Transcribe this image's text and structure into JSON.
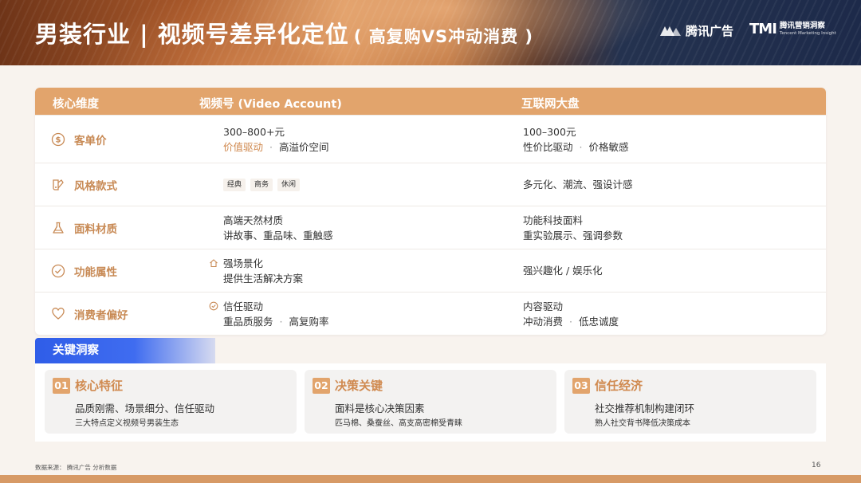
{
  "header": {
    "title": "男装行业 | 视频号差异化定位",
    "subtitle": "( 高复购VS冲动消费 )",
    "brand_tencent": "腾讯广告",
    "brand_tmi_logo": "TMI",
    "brand_tmi_cn": "腾讯营销洞察",
    "brand_tmi_en": "Tencent Marketing Insight"
  },
  "table": {
    "headers": [
      "核心维度",
      "视频号 (Video Account)",
      "互联网大盘"
    ],
    "rows": [
      {
        "dimension": "客单价",
        "icon": "dollar-circle-icon",
        "video": {
          "line1": "300–800+元",
          "line2a": "价值驱动",
          "sep": "·",
          "line2b": "高溢价空间"
        },
        "internet": {
          "line1": "100–300元",
          "line2a": "性价比驱动",
          "sep": "·",
          "line2b": "价格敏感"
        }
      },
      {
        "dimension": "风格款式",
        "icon": "style-palette-icon",
        "video": {
          "tags": [
            "经典",
            "商务",
            "休闲"
          ]
        },
        "internet": {
          "line1": "多元化、潮流、强设计感"
        }
      },
      {
        "dimension": "面料材质",
        "icon": "flask-icon",
        "video": {
          "line1": "高端天然材质",
          "line2": "讲故事、重品味、重触感"
        },
        "internet": {
          "line1": "功能科技面料",
          "line2": "重实验展示、强调参数"
        }
      },
      {
        "dimension": "功能属性",
        "icon": "check-circle-icon",
        "video": {
          "line1": "强场景化",
          "line2": "提供生活解决方案"
        },
        "internet": {
          "line1": "强兴趣化 / 娱乐化"
        }
      },
      {
        "dimension": "消费者偏好",
        "icon": "heart-icon",
        "video": {
          "line1": "信任驱动",
          "line2a": "重品质服务",
          "sep": "·",
          "line2b": "高复购率"
        },
        "internet": {
          "line1": "内容驱动",
          "line2a": "冲动消费",
          "sep": "·",
          "line2b": "低忠诚度"
        }
      }
    ]
  },
  "insights": {
    "heading": "关键洞察",
    "cards": [
      {
        "num": "01",
        "title": "核心特征",
        "line1": "品质刚需、场景细分、信任驱动",
        "line2": "三大特点定义视频号男装生态"
      },
      {
        "num": "02",
        "title": "决策关键",
        "line1": "面料是核心决策因素",
        "line2": "匹马棉、桑蚕丝、高支高密棉受青睐"
      },
      {
        "num": "03",
        "title": "信任经济",
        "line1": "社交推荐机制构建闭环",
        "line2": "熟人社交背书降低决策成本"
      }
    ]
  },
  "footer": {
    "source": "数据来源： 腾讯广告 分析数据",
    "page": "16"
  },
  "colors": {
    "accent": "#e2a46c",
    "accent_text": "#c88a55",
    "insight_blue": "#2f5de8"
  }
}
